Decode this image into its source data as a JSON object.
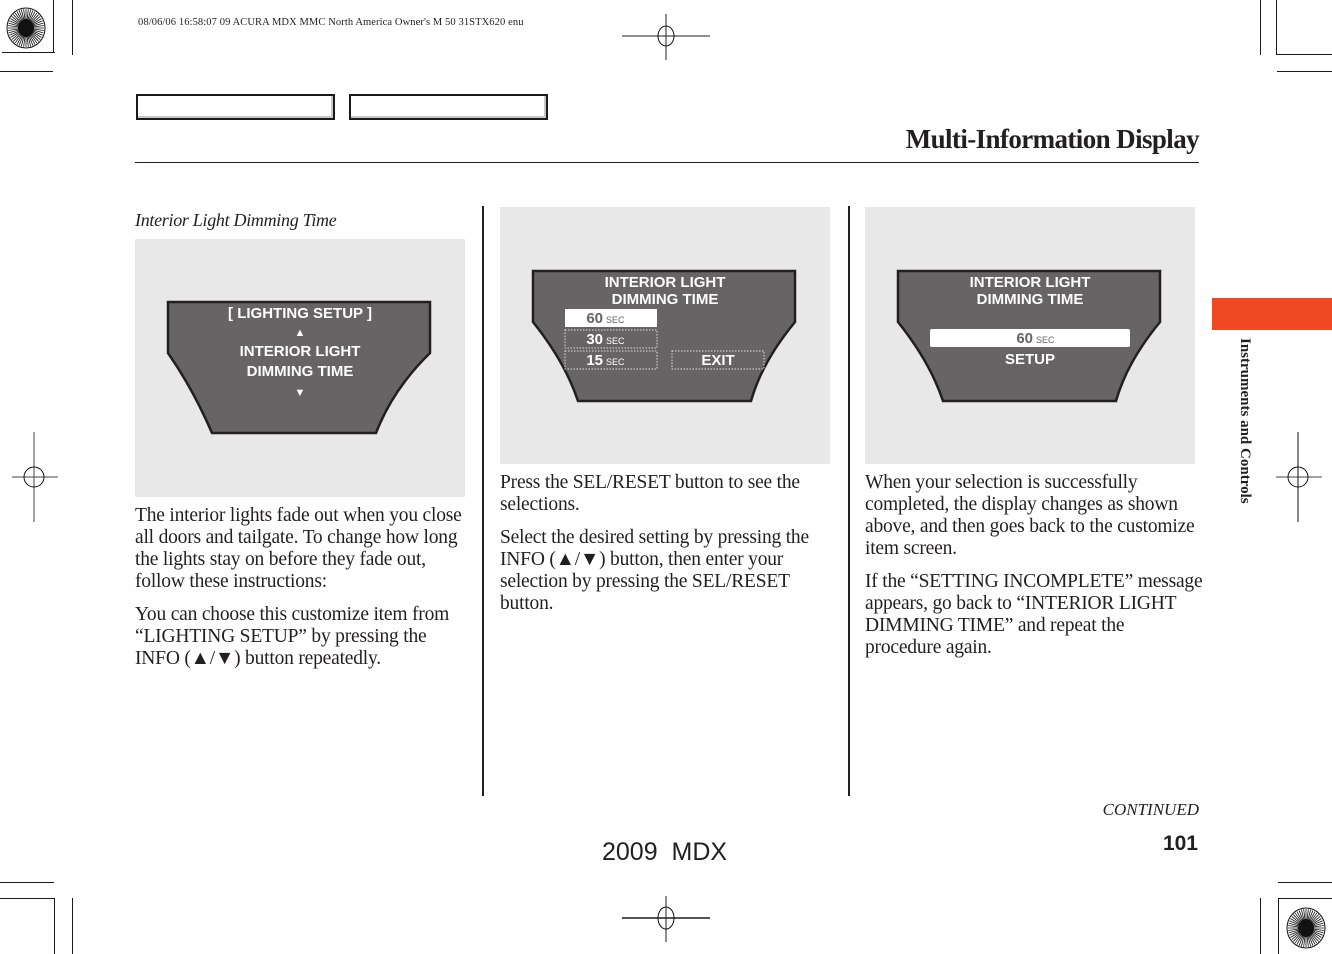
{
  "print_meta": "08/06/06 16:58:07    09 ACURA MDX MMC North America Owner's M 50 31STX620 enu",
  "header": {
    "title": "Multi-Information Display"
  },
  "section_tab": {
    "label": "Instruments and Controls",
    "color": "#ef4923"
  },
  "column1": {
    "subheading": "Interior Light Dimming Time",
    "figure": {
      "line1": "[ LIGHTING SETUP ]",
      "up_arrow": "▲",
      "line2": "INTERIOR LIGHT",
      "line3": "DIMMING TIME",
      "down_arrow": "▼"
    },
    "paragraphs": [
      "The interior lights fade out when you close all doors and tailgate. To change how long the lights stay on before they fade out, follow these instructions:",
      "You can choose this customize item from “LIGHTING SETUP” by pressing the INFO (▲/▼) button repeatedly."
    ]
  },
  "column2": {
    "figure": {
      "title1": "INTERIOR LIGHT",
      "title2": "DIMMING TIME",
      "options": [
        {
          "value": "60",
          "unit": "SEC",
          "selected": true
        },
        {
          "value": "30",
          "unit": "SEC",
          "selected": false
        },
        {
          "value": "15",
          "unit": "SEC",
          "selected": false
        }
      ],
      "exit_label": "EXIT"
    },
    "paragraphs": [
      "Press the SEL/RESET button to see the selections.",
      "Select the desired setting by pressing the INFO (▲/▼) button, then enter your selection by pressing the SEL/RESET button."
    ]
  },
  "column3": {
    "figure": {
      "title1": "INTERIOR LIGHT",
      "title2": "DIMMING TIME",
      "value": "60",
      "unit": "SEC",
      "status": "SETUP"
    },
    "paragraphs": [
      "When your selection is successfully completed, the display changes as shown above, and then goes back to the customize item screen.",
      "If the “SETTING INCOMPLETE” message appears, go back to “INTERIOR LIGHT DIMMING TIME” and repeat the procedure again."
    ]
  },
  "footer": {
    "continued": "CONTINUED",
    "page_number": "101",
    "model": "2009  MDX"
  }
}
